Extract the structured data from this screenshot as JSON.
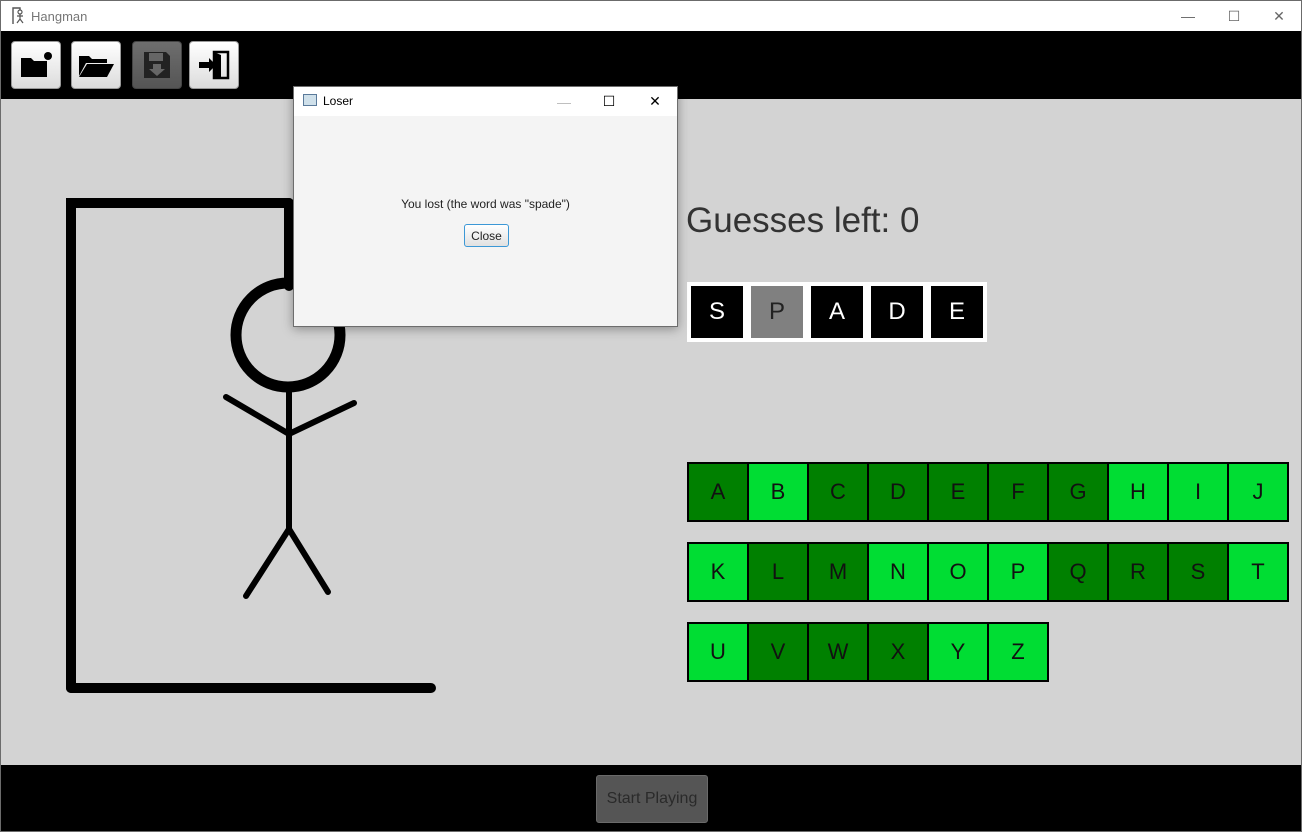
{
  "window": {
    "title": "Hangman",
    "minimize_glyph": "—",
    "maximize_glyph": "☐",
    "close_glyph": "✕"
  },
  "toolbar": {
    "buttons": [
      {
        "name": "new-game",
        "icon": "new-folder-icon",
        "enabled": true
      },
      {
        "name": "open-game",
        "icon": "open-folder-icon",
        "enabled": true
      },
      {
        "name": "save-game",
        "icon": "save-icon",
        "enabled": false
      },
      {
        "name": "exit",
        "icon": "exit-door-icon",
        "enabled": true
      }
    ]
  },
  "game": {
    "guesses_left": "Guesses left: 0",
    "word": [
      {
        "letter": "S",
        "guessed": true
      },
      {
        "letter": "P",
        "guessed": false
      },
      {
        "letter": "A",
        "guessed": true
      },
      {
        "letter": "D",
        "guessed": true
      },
      {
        "letter": "E",
        "guessed": true
      }
    ],
    "letters": [
      [
        {
          "l": "A",
          "used": true
        },
        {
          "l": "B",
          "used": false
        },
        {
          "l": "C",
          "used": true
        },
        {
          "l": "D",
          "used": true
        },
        {
          "l": "E",
          "used": true
        },
        {
          "l": "F",
          "used": true
        },
        {
          "l": "G",
          "used": true
        },
        {
          "l": "H",
          "used": false
        },
        {
          "l": "I",
          "used": false
        },
        {
          "l": "J",
          "used": false
        }
      ],
      [
        {
          "l": "K",
          "used": false
        },
        {
          "l": "L",
          "used": true
        },
        {
          "l": "M",
          "used": true
        },
        {
          "l": "N",
          "used": false
        },
        {
          "l": "O",
          "used": false
        },
        {
          "l": "P",
          "used": false
        },
        {
          "l": "Q",
          "used": true
        },
        {
          "l": "R",
          "used": true
        },
        {
          "l": "S",
          "used": true
        },
        {
          "l": "T",
          "used": false
        }
      ],
      [
        {
          "l": "U",
          "used": false
        },
        {
          "l": "V",
          "used": true
        },
        {
          "l": "W",
          "used": true
        },
        {
          "l": "X",
          "used": true
        },
        {
          "l": "Y",
          "used": false
        },
        {
          "l": "Z",
          "used": false
        }
      ]
    ],
    "colors": {
      "used_letter": "#008000",
      "unused_letter": "#00dd33",
      "revealed_cell": "#000000",
      "missed_cell": "#808080"
    }
  },
  "bottom": {
    "start_label": "Start Playing",
    "start_enabled": false
  },
  "dialog": {
    "title": "Loser",
    "message": "You lost (the word was \"spade\")",
    "close_label": "Close",
    "minimize_glyph": "—",
    "maximize_glyph": "☐",
    "close_glyph": "✕"
  }
}
